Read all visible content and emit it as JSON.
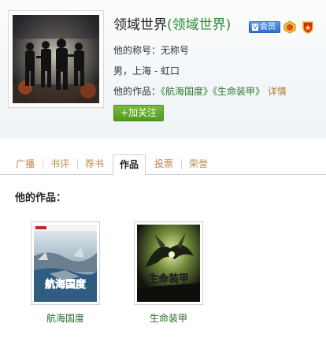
{
  "profile": {
    "name": "领域世界",
    "name_paren": "(领域世界)",
    "vip_label": "会员",
    "nickname_label": "他的称号：",
    "nickname_value": "无称号",
    "gender_location": "男，上海 - 虹口",
    "works_label": "他的作品：",
    "works": [
      "《航海国度》",
      "《生命装甲》"
    ],
    "detail_link": "详情",
    "follow_button": "+加关注"
  },
  "tabs": [
    {
      "label": "广播",
      "active": false
    },
    {
      "label": "书评",
      "active": false
    },
    {
      "label": "荐书",
      "active": false
    },
    {
      "label": "作品",
      "active": true
    },
    {
      "label": "投票",
      "active": false
    },
    {
      "label": "荣誉",
      "active": false
    }
  ],
  "works_section": {
    "title": "他的作品：",
    "books": [
      {
        "title": "航海国度",
        "cover_text": "航海国度"
      },
      {
        "title": "生命装甲",
        "cover_text": "生命装甲"
      }
    ]
  },
  "colors": {
    "link_green": "#2b7a2b",
    "tab_orange": "#c08850",
    "button_green": "#5aa52a"
  }
}
